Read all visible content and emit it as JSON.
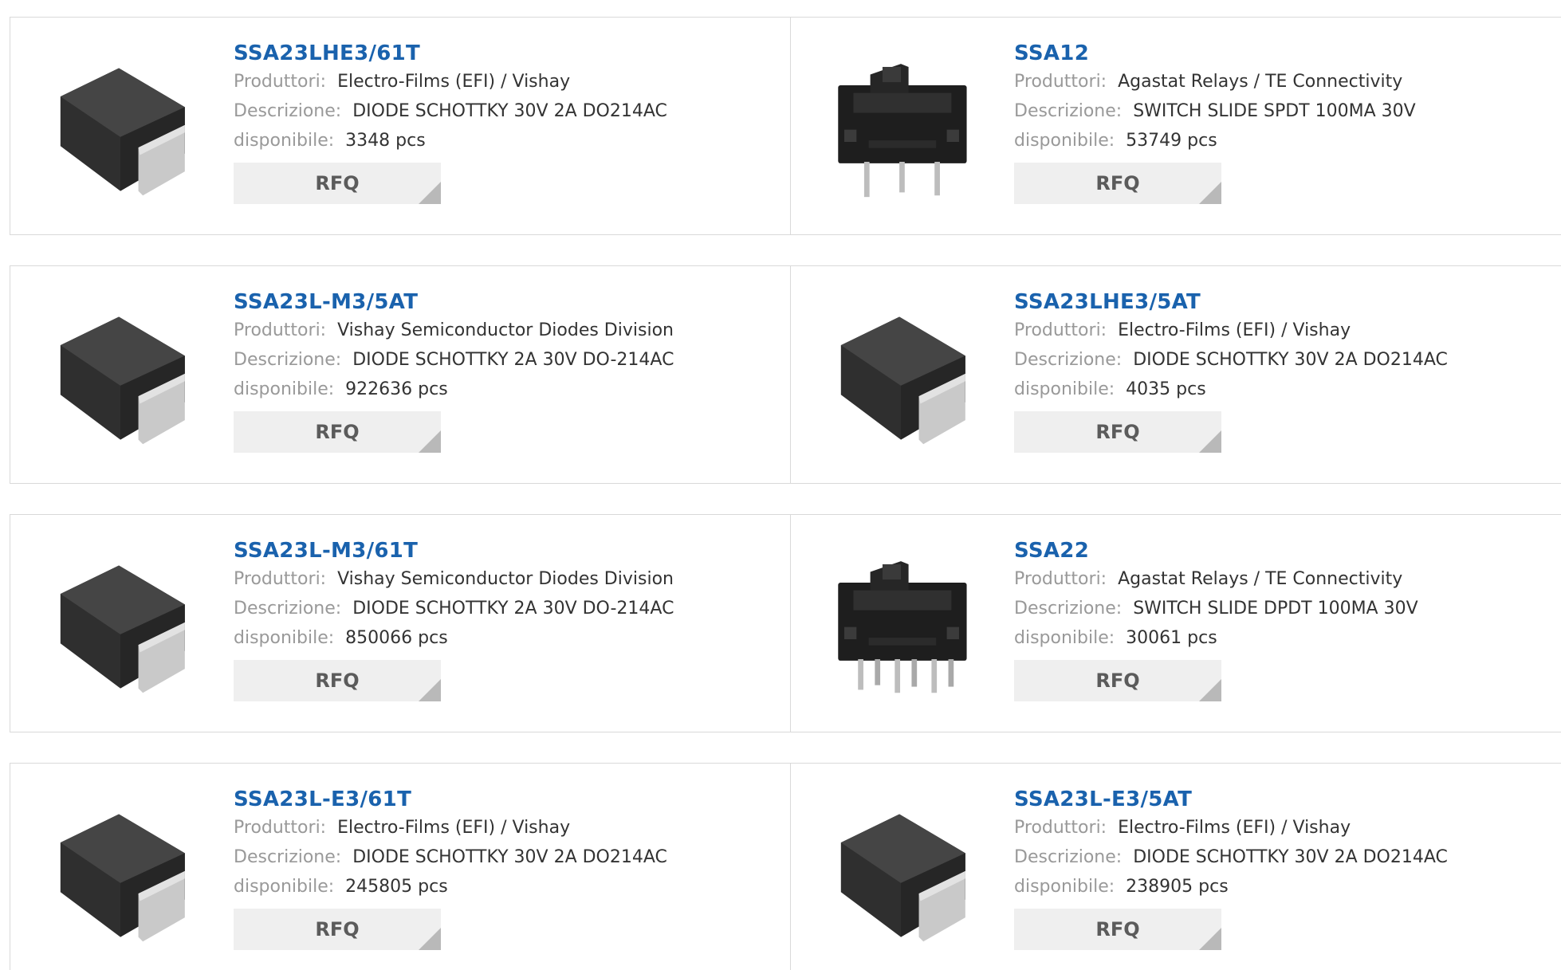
{
  "labels": {
    "manufacturer": "Produttori:",
    "description": "Descrizione:",
    "available": "disponibile:"
  },
  "rfq_label": "RFQ",
  "products": [
    {
      "part": "SSA23LHE3/61T",
      "manufacturer": "Electro-Films (EFI) / Vishay",
      "description": "DIODE SCHOTTKY 30V 2A DO214AC",
      "available": "3348 pcs",
      "image": "diode-do214ac-icon"
    },
    {
      "part": "SSA12",
      "manufacturer": "Agastat Relays / TE Connectivity",
      "description": "SWITCH SLIDE SPDT 100MA 30V",
      "available": "53749 pcs",
      "image": "slide-switch-spdt-icon"
    },
    {
      "part": "SSA23L-M3/5AT",
      "manufacturer": "Vishay Semiconductor Diodes Division",
      "description": "DIODE SCHOTTKY 2A 30V DO-214AC",
      "available": "922636 pcs",
      "image": "diode-do214ac-icon"
    },
    {
      "part": "SSA23LHE3/5AT",
      "manufacturer": "Electro-Films (EFI) / Vishay",
      "description": "DIODE SCHOTTKY 30V 2A DO214AC",
      "available": "4035 pcs",
      "image": "diode-do214ac-icon"
    },
    {
      "part": "SSA23L-M3/61T",
      "manufacturer": "Vishay Semiconductor Diodes Division",
      "description": "DIODE SCHOTTKY 2A 30V DO-214AC",
      "available": "850066 pcs",
      "image": "diode-do214ac-icon"
    },
    {
      "part": "SSA22",
      "manufacturer": "Agastat Relays / TE Connectivity",
      "description": "SWITCH SLIDE DPDT 100MA 30V",
      "available": "30061 pcs",
      "image": "slide-switch-dpdt-icon"
    },
    {
      "part": "SSA23L-E3/61T",
      "manufacturer": "Electro-Films (EFI) / Vishay",
      "description": "DIODE SCHOTTKY 30V 2A DO214AC",
      "available": "245805 pcs",
      "image": "diode-do214ac-icon"
    },
    {
      "part": "SSA23L-E3/5AT",
      "manufacturer": "Electro-Films (EFI) / Vishay",
      "description": "DIODE SCHOTTKY 30V 2A DO214AC",
      "available": "238905 pcs",
      "image": "diode-do214ac-icon"
    }
  ]
}
